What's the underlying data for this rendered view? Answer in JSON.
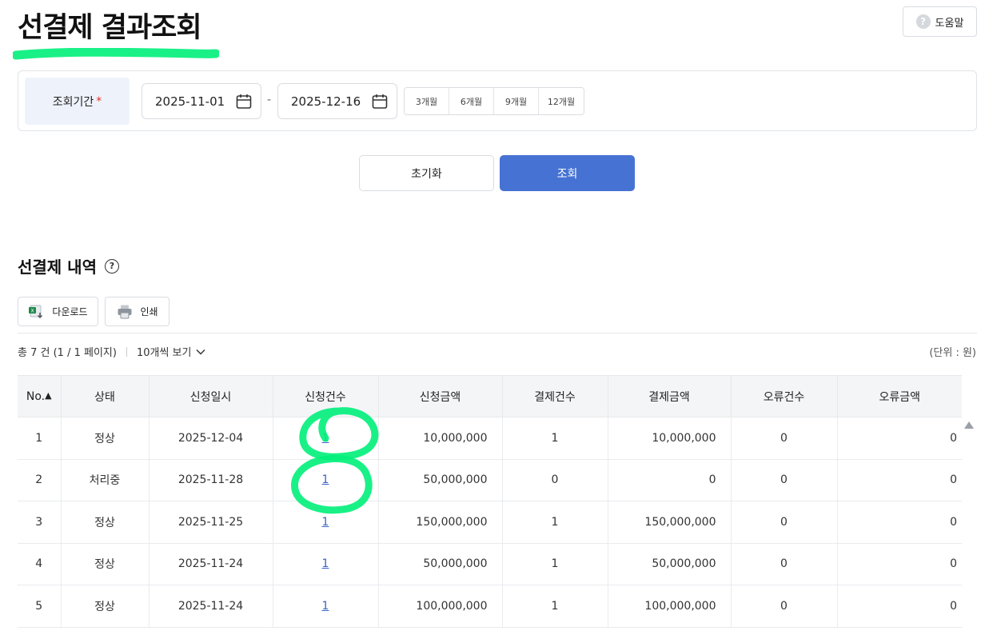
{
  "header": {
    "title": "선결제 결과조회",
    "help_label": "도움말",
    "help_icon": "question-circle-icon"
  },
  "filter": {
    "label": "조회기간",
    "required_mark": "*",
    "start_date": "2025-11-01",
    "end_date": "2025-12-16",
    "dash": "-",
    "periods": [
      "3개월",
      "6개월",
      "9개월",
      "12개월"
    ]
  },
  "actions": {
    "reset_label": "초기화",
    "search_label": "조회"
  },
  "section": {
    "title": "선결제 내역",
    "download_label": "다운로드",
    "print_label": "인쇄",
    "summary": "총 7 건 (1 / 1 페이지)",
    "page_size": "10개씩 보기",
    "unit": "(단위 : 원)"
  },
  "table": {
    "sort_indicator": "▲",
    "headers": [
      "No.",
      "상태",
      "신청일시",
      "신청건수",
      "신청금액",
      "결제건수",
      "결제금액",
      "오류건수",
      "오류금액"
    ],
    "rows": [
      [
        "1",
        "정상",
        "2025-12-04",
        "1",
        "10,000,000",
        "1",
        "10,000,000",
        "0",
        "0"
      ],
      [
        "2",
        "처리중",
        "2025-11-28",
        "1",
        "50,000,000",
        "0",
        "0",
        "0",
        "0"
      ],
      [
        "3",
        "정상",
        "2025-11-25",
        "1",
        "150,000,000",
        "1",
        "150,000,000",
        "0",
        "0"
      ],
      [
        "4",
        "정상",
        "2025-11-24",
        "1",
        "50,000,000",
        "1",
        "50,000,000",
        "0",
        "0"
      ],
      [
        "5",
        "정상",
        "2025-11-24",
        "1",
        "100,000,000",
        "1",
        "100,000,000",
        "0",
        "0"
      ]
    ]
  },
  "colors": {
    "primary": "#4673d3",
    "highlight": "#00f07a",
    "link": "#3b63c9",
    "required": "#e03131"
  }
}
